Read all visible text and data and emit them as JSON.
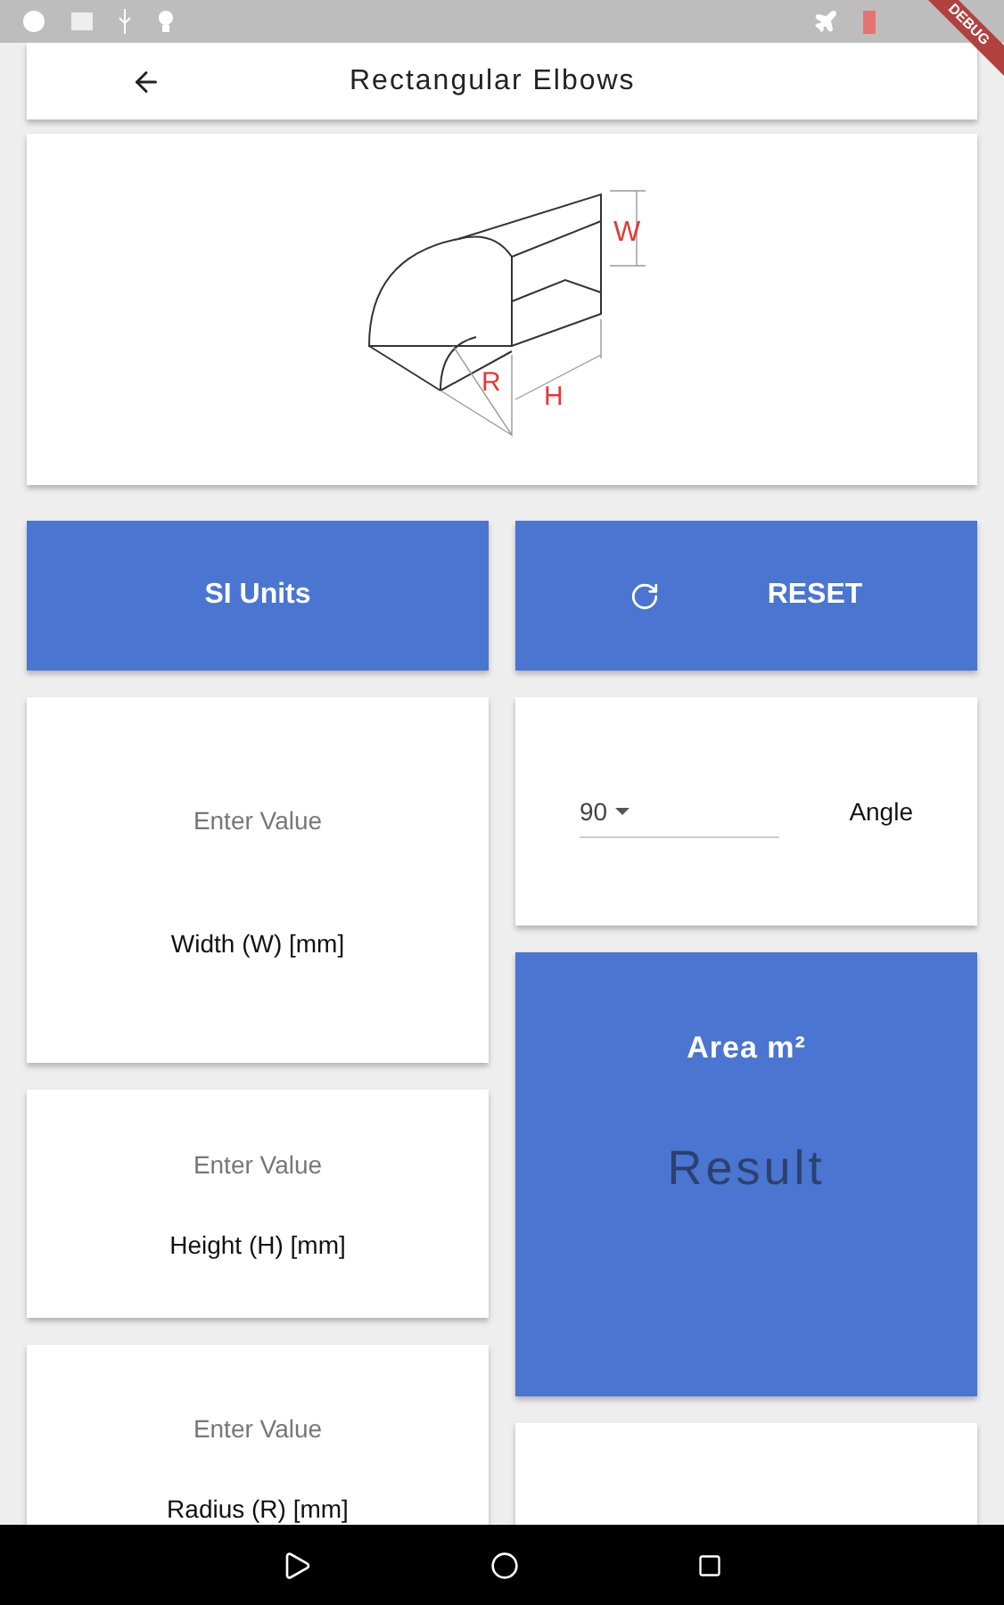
{
  "app_bar": {
    "title": "Rectangular Elbows"
  },
  "debug_banner": "DEBUG",
  "diagram": {
    "labels": [
      "W",
      "R",
      "H"
    ]
  },
  "buttons": [
    {
      "kind": "units",
      "label": "SI Units"
    },
    {
      "kind": "reset",
      "label": "RESET"
    }
  ],
  "inputs": [
    {
      "placeholder": "Enter Value",
      "label": "Width (W) [mm]"
    },
    {
      "placeholder": "Enter Value",
      "label": "Height (H) [mm]"
    },
    {
      "placeholder": "Enter Value",
      "label": "Radius (R) [mm]"
    }
  ],
  "angle": {
    "value": "90",
    "label": "Angle"
  },
  "result": {
    "title": "Area m²",
    "value": "Result"
  }
}
